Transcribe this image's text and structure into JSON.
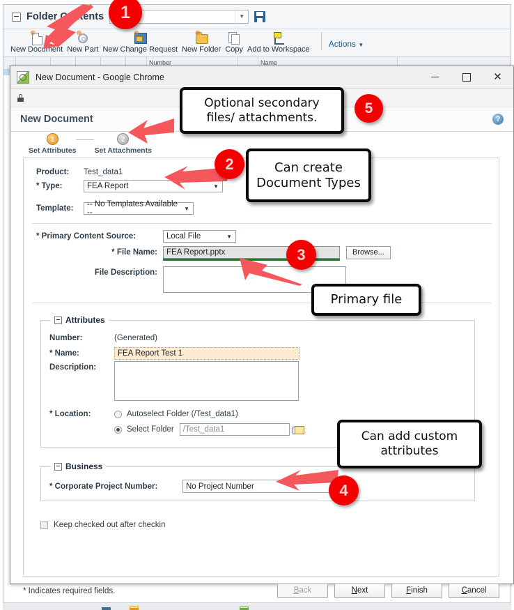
{
  "background_app": {
    "panel_title": "Folder Contents",
    "folder_select_value": "",
    "save_icon": "save-icon",
    "toolbar": {
      "items": [
        {
          "label": "New Document",
          "icon": "new-document-icon"
        },
        {
          "label": "New Part",
          "icon": "new-part-icon"
        },
        {
          "label": "New Change Request",
          "icon": "new-change-request-icon"
        },
        {
          "label": "New Folder",
          "icon": "new-folder-icon"
        },
        {
          "label": "Copy",
          "icon": "copy-icon"
        },
        {
          "label": "Add to Workspace",
          "icon": "add-to-workspace-icon"
        }
      ],
      "actions_label": "Actions"
    },
    "grid_headers": [
      "",
      "",
      "",
      "",
      "",
      "Number",
      "",
      "Name"
    ]
  },
  "chrome_window": {
    "title": "New Document - Google Chrome",
    "favicon": "windchill-favicon",
    "minimize": "–",
    "maximize": "□",
    "close": "✕",
    "address_bar": {
      "lock_icon": "lock-icon",
      "url": ""
    }
  },
  "page": {
    "title": "New Document",
    "help_icon": "help-icon",
    "wizard": {
      "steps": [
        {
          "num": "1",
          "label": "Set Attributes",
          "state": "active"
        },
        {
          "num": "2",
          "label": "Set Attachments",
          "state": "inactive"
        }
      ]
    },
    "product": {
      "label": "Product:",
      "value": "Test_data1"
    },
    "type": {
      "label": "* Type:",
      "value": "FEA Report"
    },
    "template": {
      "label": "Template:",
      "value": "-- No Templates Available --"
    },
    "primary_content_source": {
      "label": "* Primary Content Source:",
      "value": "Local File"
    },
    "file_name": {
      "label": "* File Name:",
      "value": "FEA Report.pptx",
      "browse_label": "Browse..."
    },
    "file_description": {
      "label": "File Description:",
      "value": ""
    },
    "attributes_section": {
      "legend": "Attributes",
      "number": {
        "label": "Number:",
        "value": "(Generated)"
      },
      "name": {
        "label": "* Name:",
        "value": "FEA Report Test 1"
      },
      "description": {
        "label": "Description:",
        "value": ""
      },
      "location": {
        "label": "* Location:",
        "options": [
          {
            "label": "Autoselect Folder (/Test_data1)",
            "selected": false
          },
          {
            "label": "Select Folder",
            "selected": true
          }
        ],
        "folder_value": "/Test_data1",
        "folder_picker_icon": "folder-picker-icon"
      }
    },
    "business_section": {
      "legend": "Business",
      "corporate_project_number": {
        "label": "* Corporate Project Number:",
        "value": "No Project Number"
      }
    },
    "keep_checked_out": {
      "label": "Keep checked out after checkin",
      "checked": false
    },
    "footer": {
      "required_note": "* Indicates required fields.",
      "buttons": [
        {
          "label": "Back",
          "accel": "B",
          "disabled": true
        },
        {
          "label": "Next",
          "accel": "N",
          "disabled": false
        },
        {
          "label": "Finish",
          "accel": "F",
          "disabled": false
        },
        {
          "label": "Cancel",
          "accel": "C",
          "disabled": false
        }
      ]
    }
  },
  "annotations": {
    "badges": [
      {
        "num": "1"
      },
      {
        "num": "2"
      },
      {
        "num": "3"
      },
      {
        "num": "4"
      },
      {
        "num": "5"
      }
    ],
    "callouts": [
      {
        "line1": "Optional secondary",
        "line2": "files/ attachments."
      },
      {
        "line1": "Can create",
        "line2": "Document Types"
      },
      {
        "line1": "Primary file",
        "line2": ""
      },
      {
        "line1": "Can add custom",
        "line2": "attributes"
      }
    ],
    "accent_color": "#f40000",
    "arrow_color": "#f4585c"
  }
}
